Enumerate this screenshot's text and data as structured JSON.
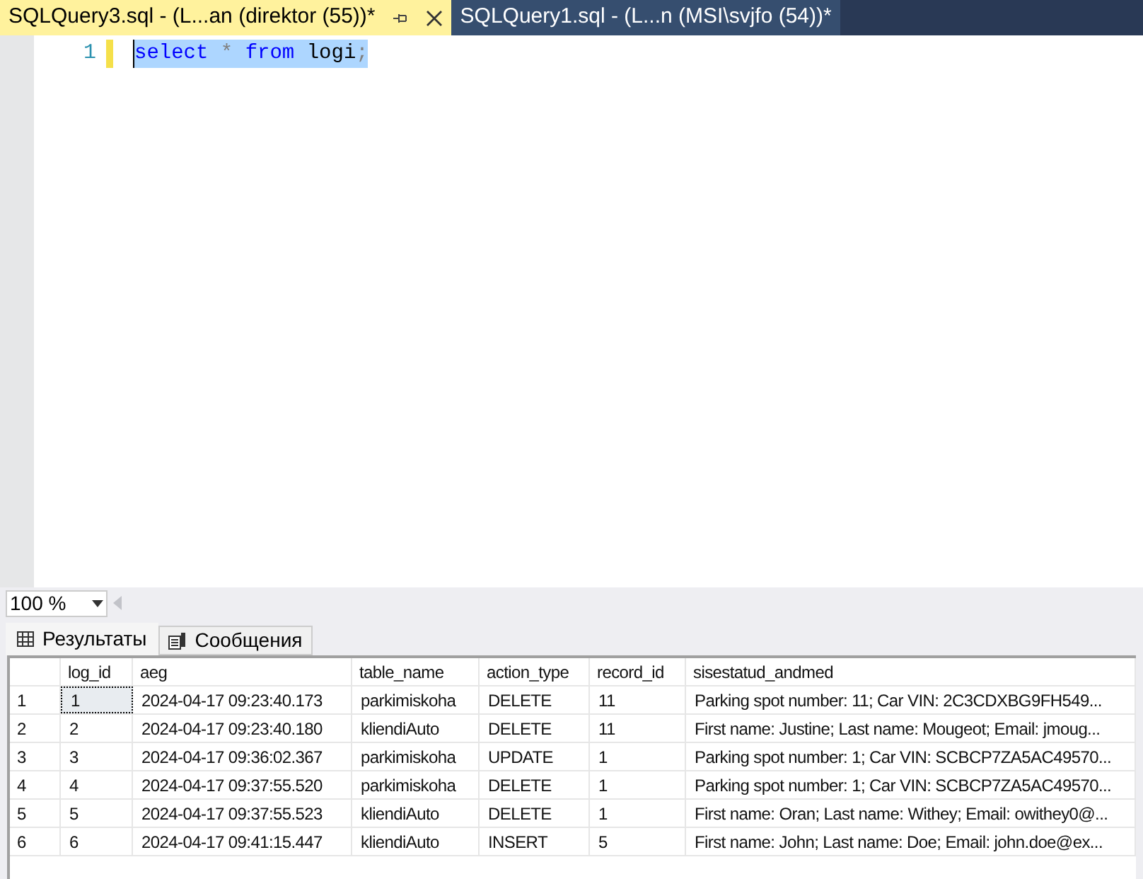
{
  "tabs": [
    {
      "label": "SQLQuery3.sql - (L...an (direktor (55))*",
      "selected": true
    },
    {
      "label": "SQLQuery1.sql - (L...n (MSI\\svjfo (54))*",
      "selected": false
    }
  ],
  "editor": {
    "lines": [
      {
        "number": "1",
        "selected": true,
        "changed": true,
        "tokens": [
          {
            "text": "select",
            "kind": "keyword"
          },
          {
            "text": "*",
            "kind": "operator"
          },
          {
            "text": "from",
            "kind": "keyword"
          },
          {
            "text": "logi",
            "kind": "name"
          },
          {
            "text": ";",
            "kind": "operator"
          }
        ]
      }
    ]
  },
  "zoom": {
    "value": "100 %"
  },
  "result_tabs": [
    {
      "label": "Результаты",
      "selected": true,
      "kind": "grid"
    },
    {
      "label": "Сообщения",
      "selected": false,
      "kind": "messages"
    }
  ],
  "table": {
    "columns": [
      "log_id",
      "aeg",
      "table_name",
      "action_type",
      "record_id",
      "sisestatud_andmed"
    ],
    "rows": [
      {
        "number": "1",
        "focused": true,
        "cells": [
          "1",
          "2024-04-17 09:23:40.173",
          "parkimiskoha",
          "DELETE",
          "11",
          "Parking spot number: 11; Car VIN: 2C3CDXBG9FH549..."
        ]
      },
      {
        "number": "2",
        "focused": false,
        "cells": [
          "2",
          "2024-04-17 09:23:40.180",
          "kliendiAuto",
          "DELETE",
          "11",
          "First name: Justine; Last name: Mougeot; Email: jmoug..."
        ]
      },
      {
        "number": "3",
        "focused": false,
        "cells": [
          "3",
          "2024-04-17 09:36:02.367",
          "parkimiskoha",
          "UPDATE",
          "1",
          "Parking spot number: 1; Car VIN: SCBCP7ZA5AC49570..."
        ]
      },
      {
        "number": "4",
        "focused": false,
        "cells": [
          "4",
          "2024-04-17 09:37:55.520",
          "parkimiskoha",
          "DELETE",
          "1",
          "Parking spot number: 1; Car VIN: SCBCP7ZA5AC49570..."
        ]
      },
      {
        "number": "5",
        "focused": false,
        "cells": [
          "5",
          "2024-04-17 09:37:55.523",
          "kliendiAuto",
          "DELETE",
          "1",
          "First name: Oran; Last name: Withey; Email: owithey0@..."
        ]
      },
      {
        "number": "6",
        "focused": false,
        "cells": [
          "6",
          "2024-04-17 09:41:15.447",
          "kliendiAuto",
          "INSERT",
          "5",
          "First name: John; Last name: Doe; Email: john.doe@ex..."
        ]
      }
    ]
  }
}
